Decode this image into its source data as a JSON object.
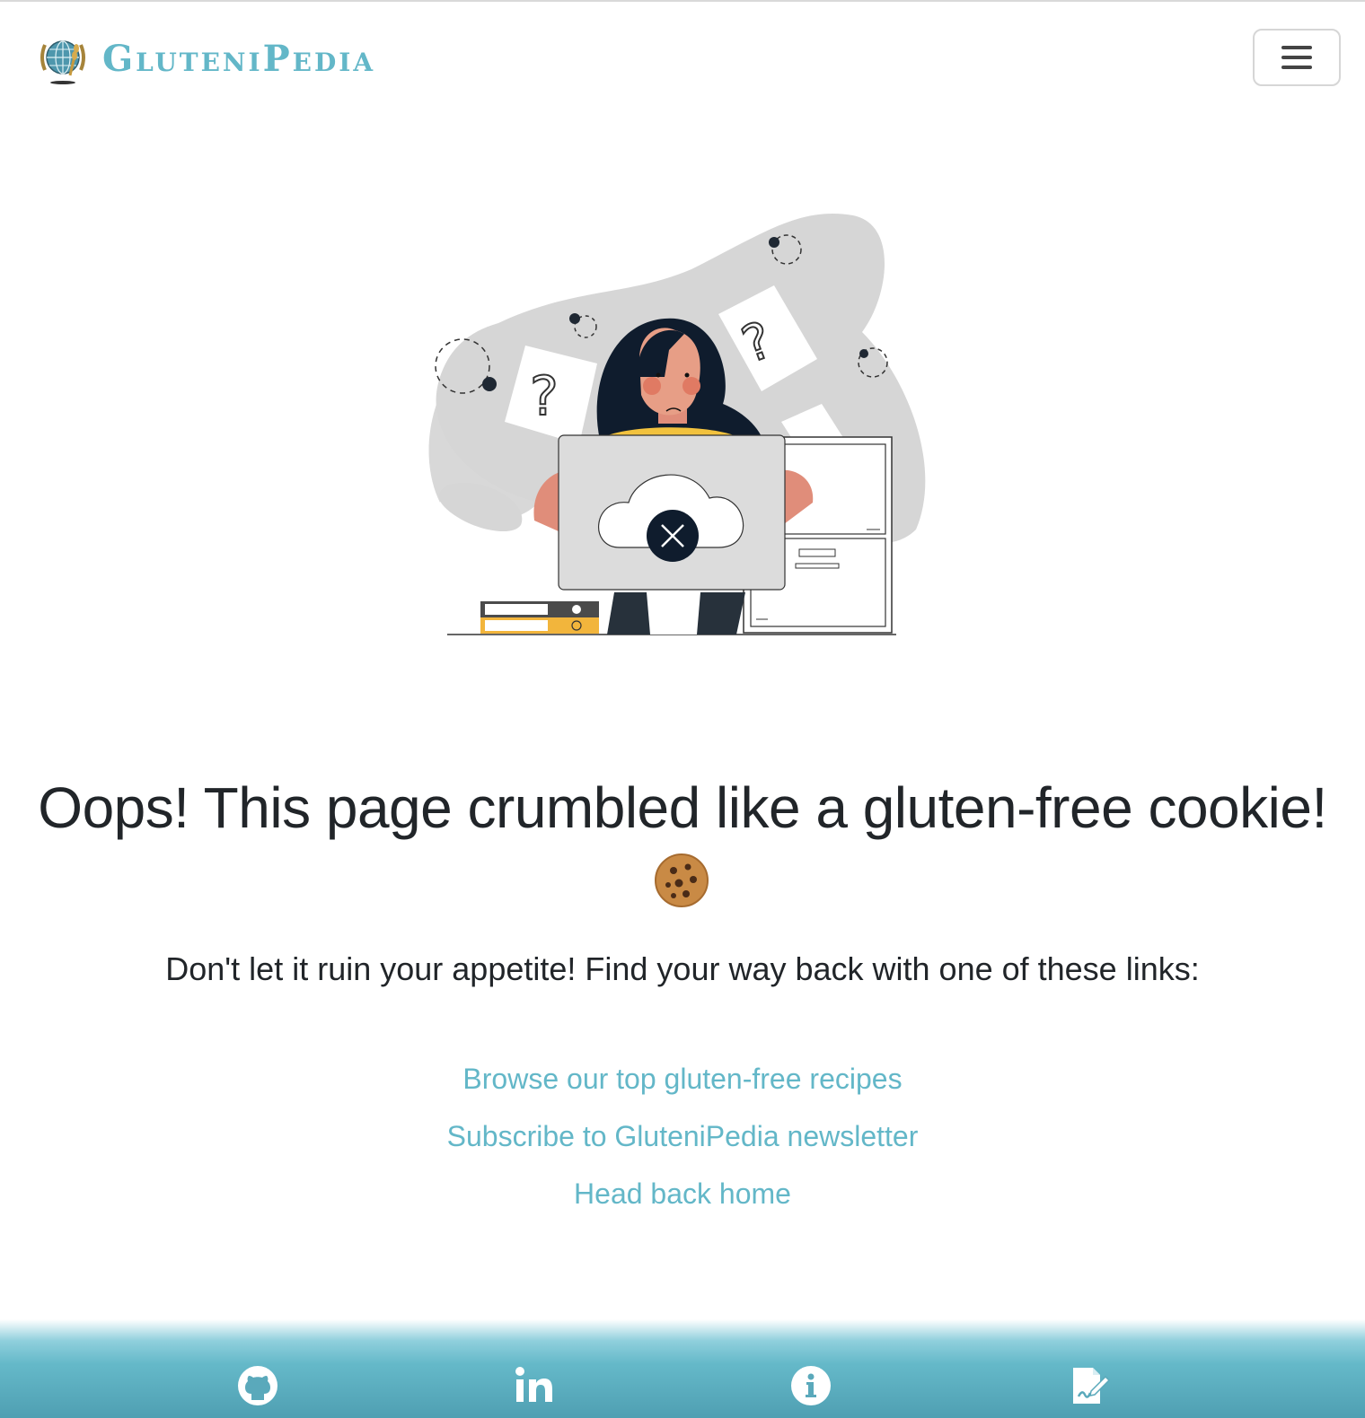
{
  "navbar": {
    "brand_name": "GluteniPedia",
    "logo_icon": "globe-wheat-logo",
    "menu_icon": "hamburger-menu-icon",
    "brand_color": "#63b7c8"
  },
  "illustration": {
    "name": "confused-person-at-laptop-illustration",
    "error_icon": "cloud-error-icon"
  },
  "error": {
    "headline": "Oops! This page crumbled like a gluten-free cookie!",
    "emoji_icon": "cookie-emoji-icon",
    "subtext": "Don't let it ruin your appetite! Find your way back with one of these links:"
  },
  "links": [
    {
      "label": "Browse our top gluten-free recipes"
    },
    {
      "label": "Subscribe to GluteniPedia newsletter"
    },
    {
      "label": "Head back home"
    }
  ],
  "footer": {
    "icons": [
      "github-icon",
      "linkedin-icon",
      "info-icon",
      "signature-document-icon"
    ],
    "gradient_colors": [
      "#8fcfdc",
      "#4f9fb2"
    ]
  }
}
